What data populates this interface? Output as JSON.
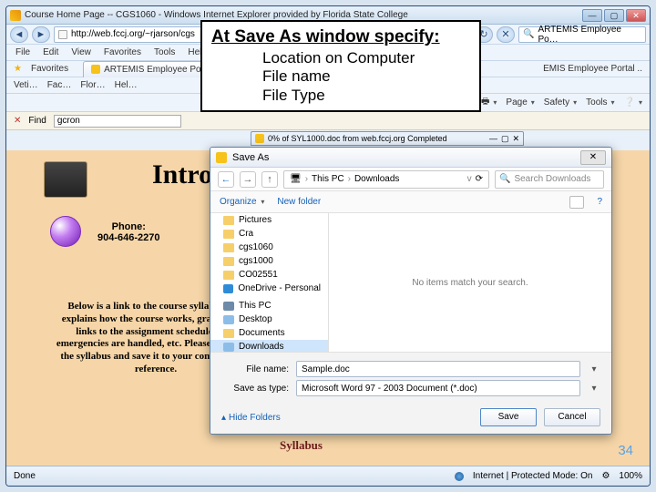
{
  "ie": {
    "title": "Course Home Page -- CGS1060 - Windows Internet Explorer provided by Florida State College",
    "url": "http://web.fccj.org/~rjarson/cgs",
    "search_placeholder": "ARTEMIS Employee Po…",
    "menus": [
      "File",
      "Edit",
      "View",
      "Favorites",
      "Tools",
      "Help"
    ],
    "favorites_label": "Favorites",
    "fav_tab": "ARTEMIS Employee Po…",
    "links": [
      "Veti…",
      "Fac…",
      "Flor…",
      "Hel…"
    ],
    "cmd": {
      "home": "",
      "page": "Page",
      "safety": "Safety",
      "tools": "Tools"
    },
    "tab_right": "EMIS Employee Portal ..",
    "find_label": "Find",
    "find_text": "gcron"
  },
  "page": {
    "intro": "Intro",
    "phone_label": "Phone:",
    "phone": "904-646-2270",
    "para": "Below is a link to the course syllabus that explains how the course works, grading, has links to the assignment schedule, how emergencies are handled, etc.  Please download the syllabus and save it to your computer for reference.",
    "syllabus": "Syllabus",
    "page_num": "34"
  },
  "status": {
    "done": "Done",
    "zone": "Internet | Protected Mode: On",
    "zoom": "100%"
  },
  "callout": {
    "h": "At Save As window specify:",
    "l1": "Location on Computer",
    "l2": "File name",
    "l3": "File Type"
  },
  "dl": {
    "text": "0% of SYL1000.doc from web.fccj.org Completed"
  },
  "saveas": {
    "title": "Save As",
    "crumb1": "This PC",
    "crumb2": "Downloads",
    "search_placeholder": "Search Downloads",
    "organize": "Organize",
    "newfolder": "New folder",
    "tree": {
      "pictures": "Pictures",
      "cra": "Cra",
      "cgs1060": "cgs1060",
      "cgs1000": "cgs1000",
      "co02551": "CO02551",
      "onedrive": "OneDrive - Personal",
      "thispc": "This PC",
      "desktop": "Desktop",
      "documents": "Documents",
      "downloads": "Downloads"
    },
    "empty": "No items match your search.",
    "filename_label": "File name:",
    "filename": "Sample.doc",
    "type_label": "Save as type:",
    "type": "Microsoft Word 97 - 2003 Document (*.doc)",
    "hide": "Hide Folders",
    "save": "Save",
    "cancel": "Cancel"
  }
}
